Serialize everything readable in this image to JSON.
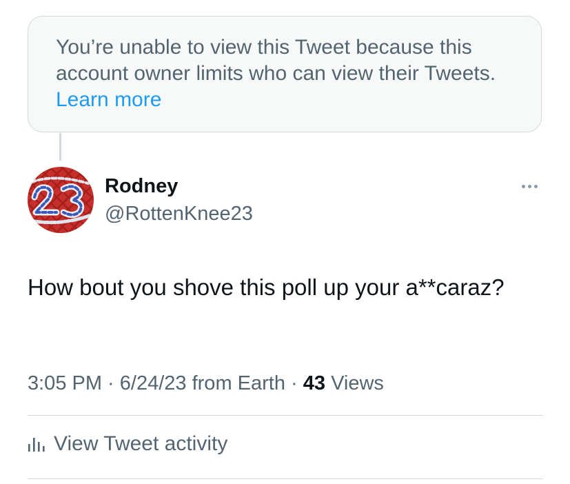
{
  "notice": {
    "text": "You’re unable to view this Tweet because this account owner limits who can view their Tweets. ",
    "link_label": "Learn more"
  },
  "author": {
    "name": "Rodney",
    "handle": "@RottenKnee23",
    "avatar_icon": "avatar-red-chain-23-icon"
  },
  "tweet": {
    "text": "How bout you shove this poll up your a**caraz?",
    "time": "3:05 PM",
    "date": "6/24/23 from Earth",
    "separator": " · ",
    "views_count": "43",
    "views_label": " Views"
  },
  "activity": {
    "label": "View Tweet activity",
    "icon": "bar-chart-icon"
  },
  "colors": {
    "accent": "#1d9bf0",
    "secondary_text": "#536471",
    "primary_text": "#0f1419",
    "border": "#cfd9de",
    "notice_bg": "#f7f9f9"
  }
}
